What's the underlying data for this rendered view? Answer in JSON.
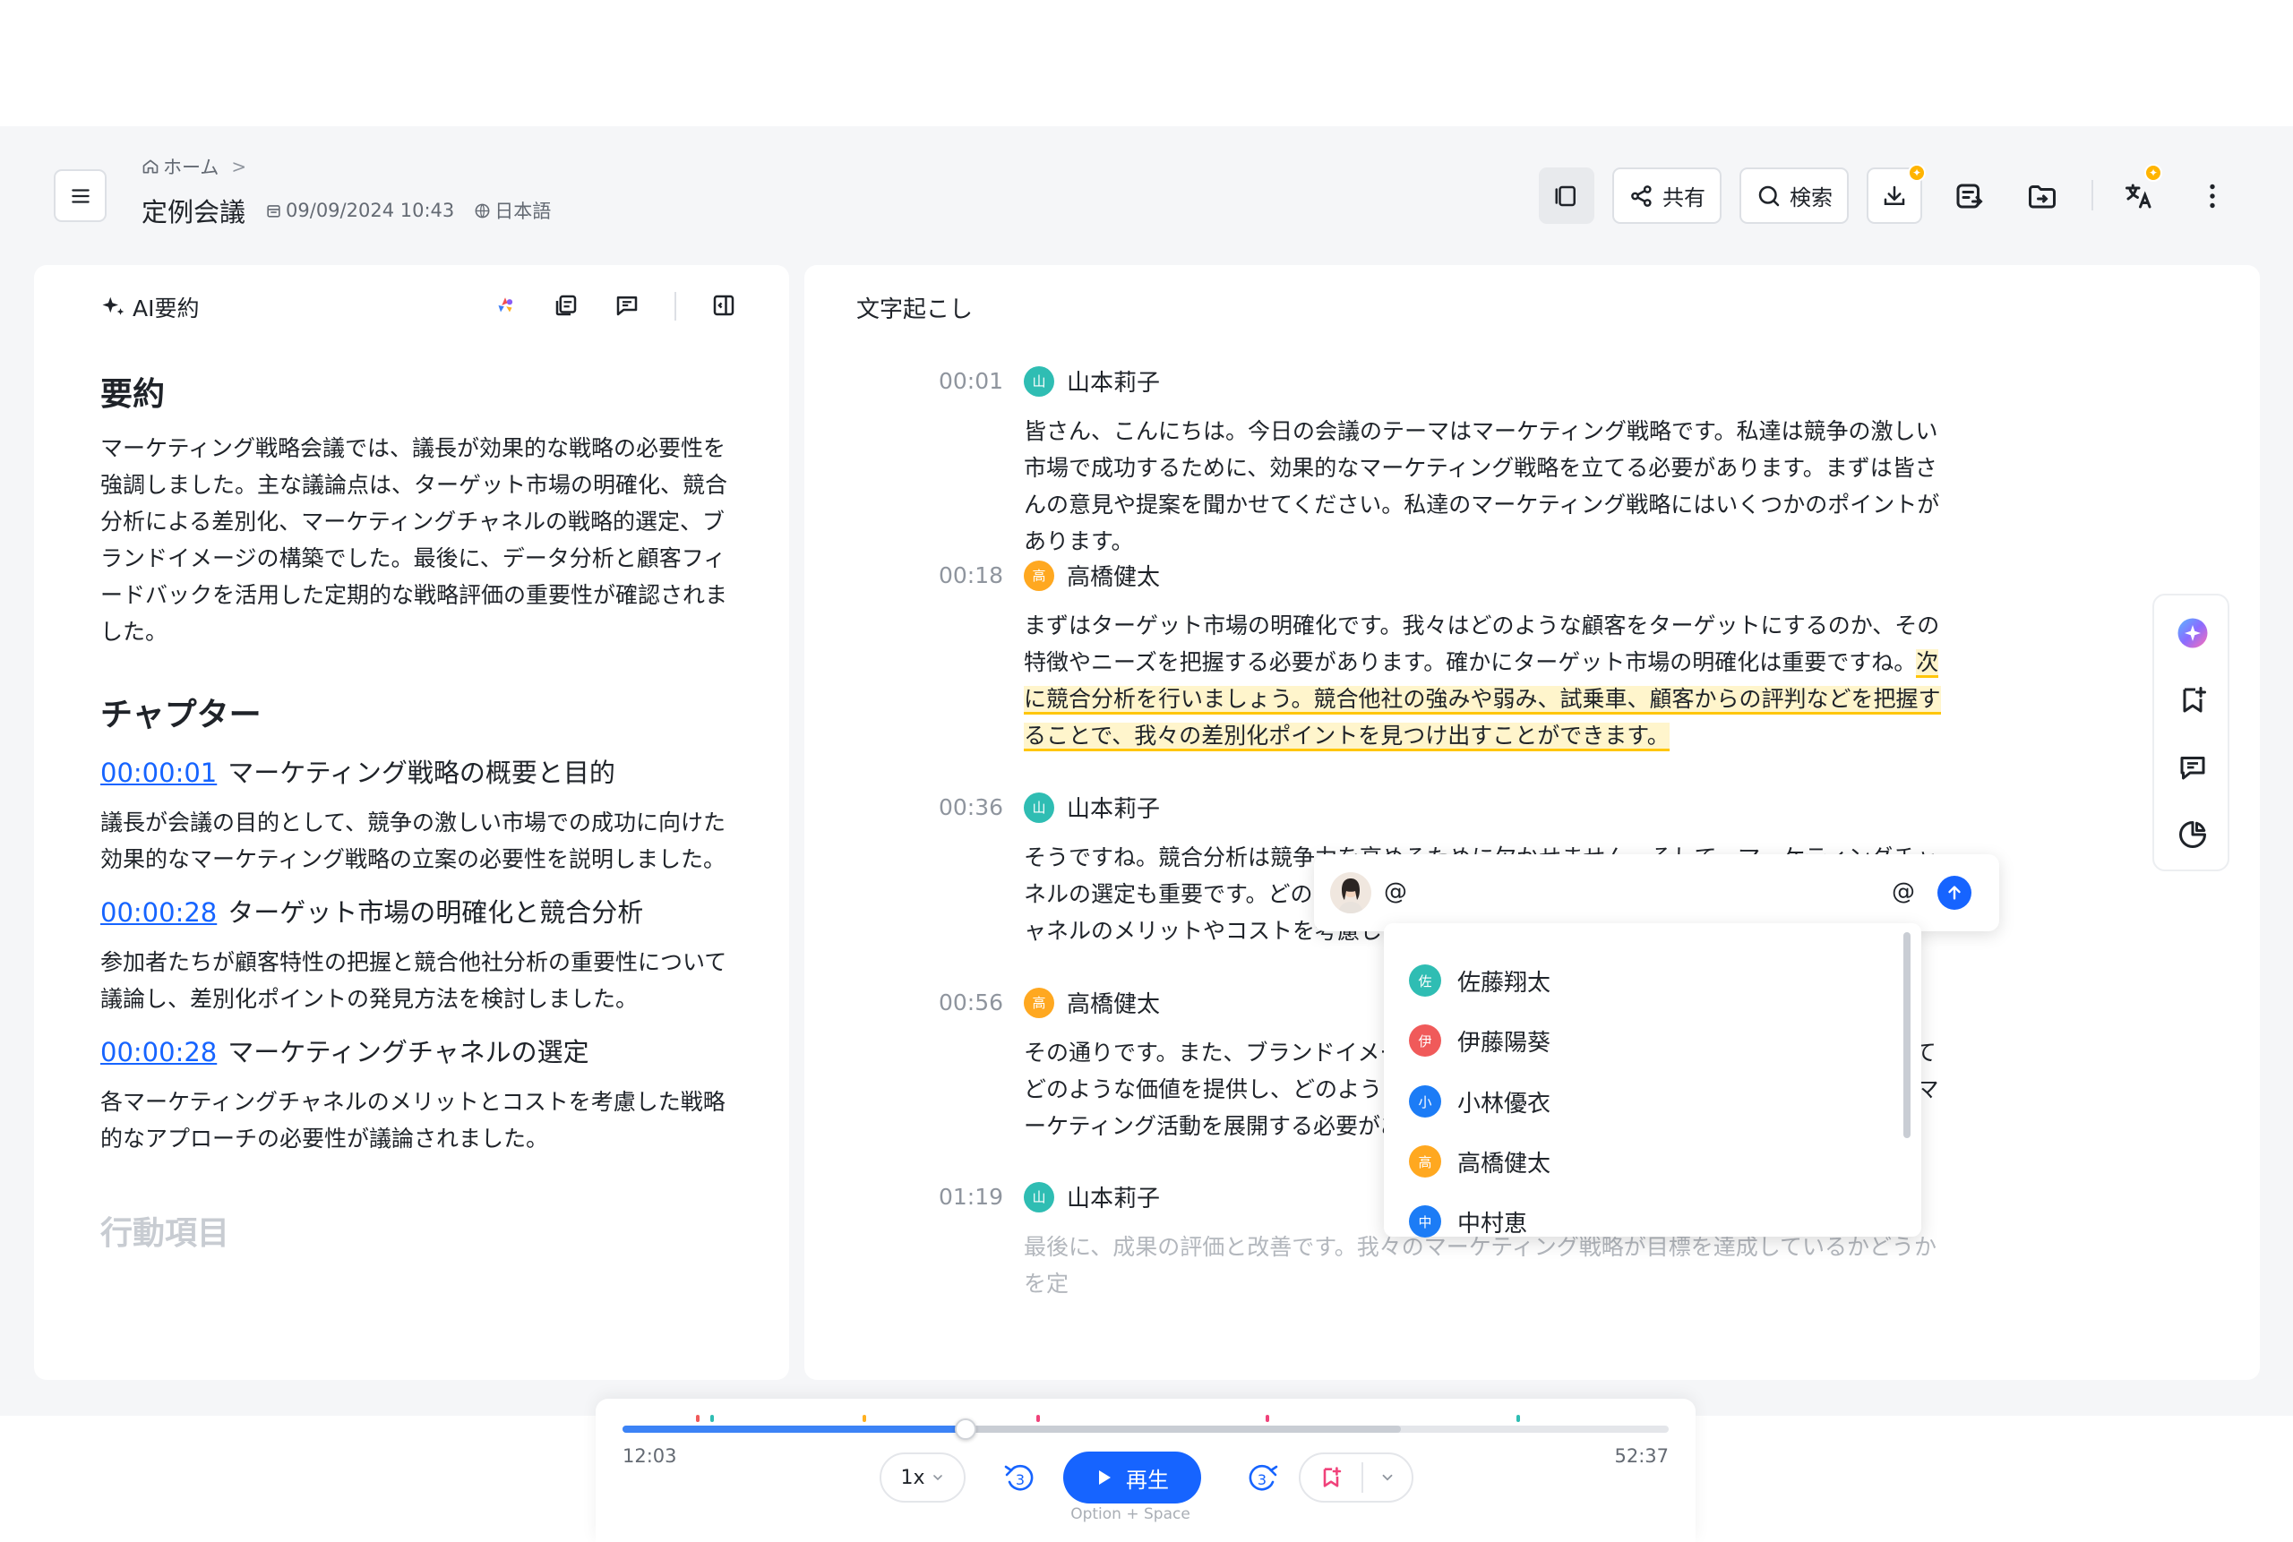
{
  "header": {
    "breadcrumb_home": "ホーム",
    "breadcrumb_chevron": ">",
    "title": "定例会議",
    "date": "09/09/2024 10:43",
    "language": "日本語",
    "share_label": "共有",
    "search_label": "検索"
  },
  "summary_panel": {
    "heading": "AI要約",
    "summary_title": "要約",
    "summary_text": "マーケティング戦略会議では、議長が効果的な戦略の必要性を強調しました。主な議論点は、ターゲット市場の明確化、競合分析による差別化、マーケティングチャネルの戦略的選定、ブランドイメージの構築でした。最後に、データ分析と顧客フィードバックを活用した定期的な戦略評価の重要性が確認されました。",
    "chapters_title": "チャプター",
    "chapters": [
      {
        "time": "00:00:01",
        "title": "マーケティング戦略の概要と目的",
        "text": "議長が会議の目的として、競争の激しい市場での成功に向けた効果的なマーケティング戦略の立案の必要性を説明しました。"
      },
      {
        "time": "00:00:28",
        "title": "ターゲット市場の明確化と競合分析",
        "text": "参加者たちが顧客特性の把握と競合他社分析の重要性について議論し、差別化ポイントの発見方法を検討しました。"
      },
      {
        "time": "00:00:28",
        "title": "マーケティングチャネルの選定",
        "text": "各マーケティングチャネルのメリットとコストを考慮した戦略的なアプローチの必要性が議論されました。"
      }
    ],
    "action_items_title": "行動項目"
  },
  "transcript": {
    "heading": "文字起こし",
    "segments": [
      {
        "time": "00:01",
        "speaker": "山本莉子",
        "initial": "山",
        "color": "#2fbdb3",
        "text": "皆さん、こんにちは。今日の会議のテーマはマーケティング戦略です。私達は競争の激しい市場で成功するために、効果的なマーケティング戦略を立てる必要があります。まずは皆さんの意見や提案を聞かせてください。私達のマーケティング戦略にはいくつかのポイントがあります。"
      },
      {
        "time": "00:18",
        "speaker": "高橋健太",
        "initial": "高",
        "color": "#ffa820",
        "text": "まずはターゲット市場の明確化です。我々はどのような顧客をターゲットにするのか、その特徴やニーズを把握する必要があります。確かにターゲット市場の明確化は重要ですね。",
        "highlight": "次に競合分析を行いましょう。競合他社の強みや弱み、試乗車、顧客からの評判などを把握することで、我々の差別化ポイントを見つけ出すことができます。"
      },
      {
        "time": "00:36",
        "speaker": "山本莉子",
        "initial": "山",
        "color": "#2fbdb3",
        "text": "そうですね。競合分析は競争力を高めるために欠かせません。そして、マーケティングチャネルの選定も重要です。どのチャネルを活用するかを慎重に検討しましょう。それぞれのチャネルのメリットやコストを考慮しましょう。"
      },
      {
        "time": "00:56",
        "speaker": "高橋健太",
        "initial": "高",
        "color": "#ffa820",
        "text": "その通りです。また、ブランドイメージの構築も大切です。我々はターゲット顧客に対してどのような価値を提供し、どのようなイメージを持ってもらいたいのか、それに基づいたマーケティング活動を展開する必要があります。"
      },
      {
        "time": "01:19",
        "speaker": "山本莉子",
        "initial": "山",
        "color": "#2fbdb3",
        "text": "最後に、成果の評価と改善です。我々のマーケティング戦略が目標を達成しているかどうかを定"
      }
    ]
  },
  "comment": {
    "input_value": "@",
    "at_symbol": "@",
    "mentions": [
      {
        "name": "佐藤翔太",
        "initial": "佐",
        "color": "#2fbdb3"
      },
      {
        "name": "伊藤陽葵",
        "initial": "伊",
        "color": "#f05a5a"
      },
      {
        "name": "小林優衣",
        "initial": "小",
        "color": "#1c7cf6"
      },
      {
        "name": "高橋健太",
        "initial": "高",
        "color": "#ffa820"
      },
      {
        "name": "中村恵",
        "initial": "中",
        "color": "#1c7cf6"
      }
    ]
  },
  "player": {
    "current_time": "12:03",
    "total_time": "52:37",
    "progress": 0.328,
    "buffered": 0.744,
    "speed": "1x",
    "skip_back": "3",
    "skip_forward": "3",
    "play_label": "再生",
    "shortcut_hint": "Option + Space"
  },
  "colors": {
    "accent": "#1664ff",
    "highlight_border": "#ffc60a",
    "highlight_fill": "#fff5cc"
  }
}
